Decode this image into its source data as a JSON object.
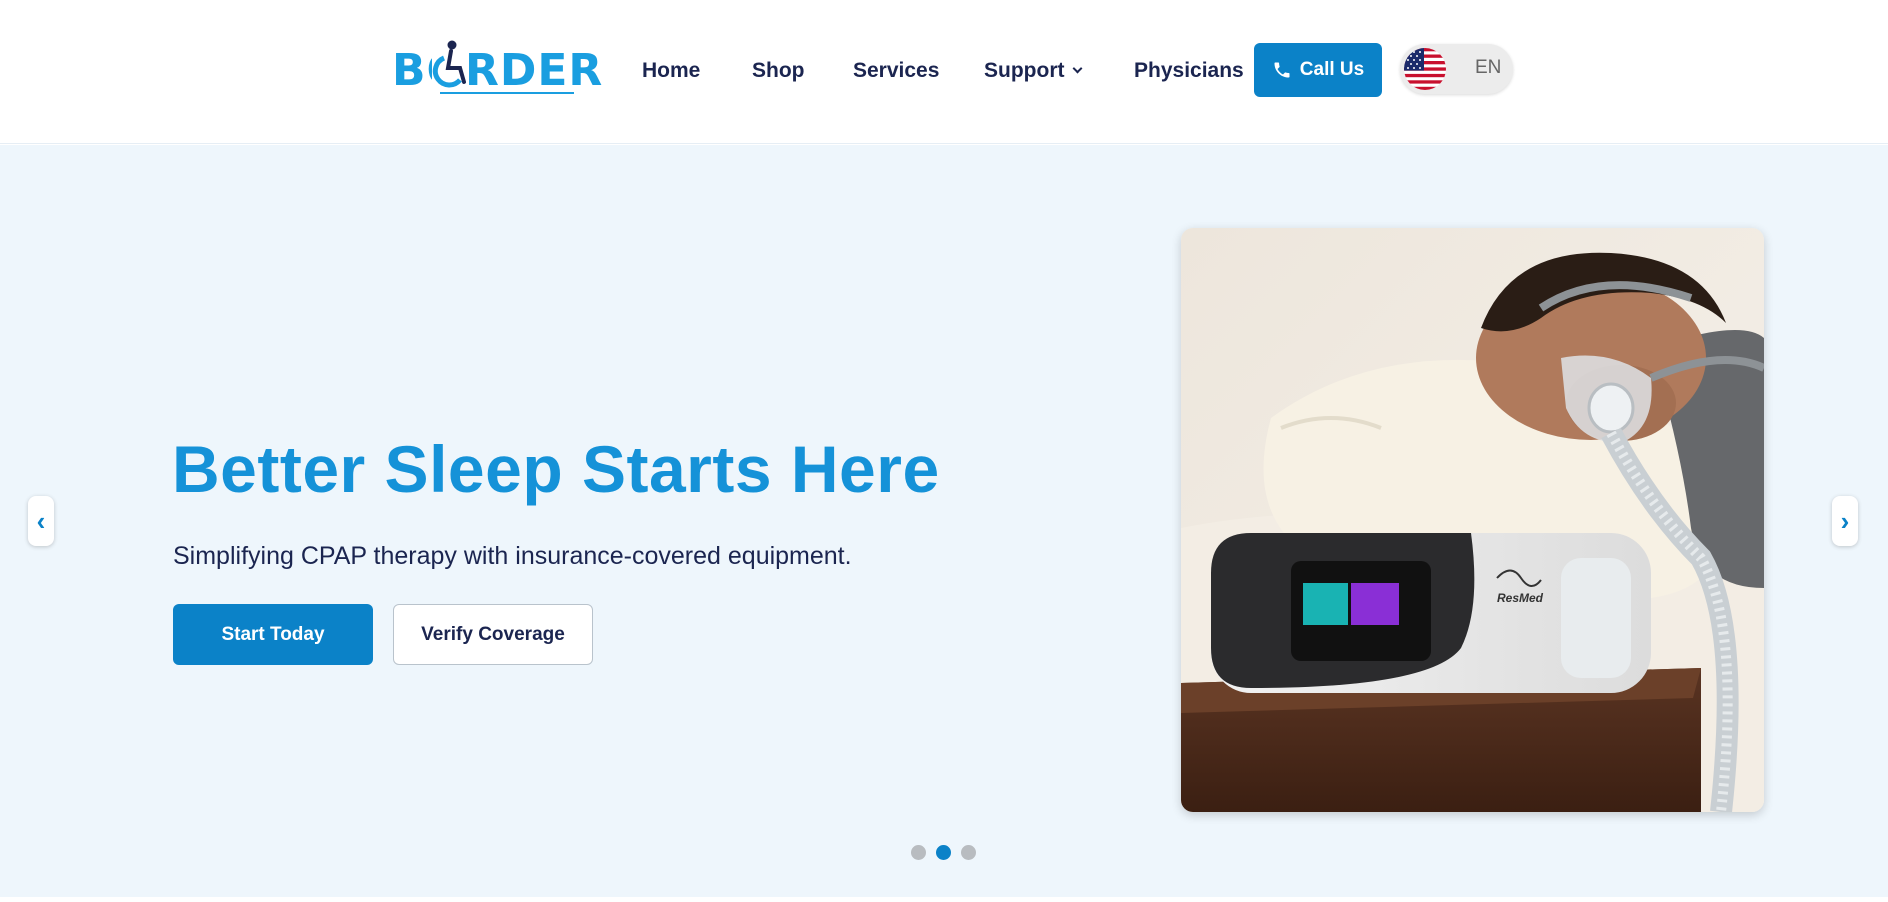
{
  "header": {
    "logo_text": "BORDER",
    "nav": [
      {
        "label": "Home"
      },
      {
        "label": "Shop"
      },
      {
        "label": "Services"
      },
      {
        "label": "Support"
      },
      {
        "label": "Physicians"
      }
    ],
    "call_label": "Call Us",
    "language": "EN"
  },
  "hero": {
    "title": "Better Sleep Starts Here",
    "subtitle": "Simplifying CPAP therapy with insurance-covered equipment.",
    "primary_button": "Start Today",
    "secondary_button": "Verify Coverage",
    "prev_arrow": "‹",
    "next_arrow": "›",
    "device_brand": "ResMed",
    "slides_total": 3,
    "active_slide": 2
  },
  "colors": {
    "brand_blue": "#1592d8",
    "button_blue": "#0b82c8",
    "hero_bg": "#eef6fc",
    "nav_text": "#1b2550"
  },
  "icons": [
    "wheelchair-figure-icon",
    "phone-icon",
    "us-flag-icon",
    "chevron-down-icon",
    "chevron-left-icon",
    "chevron-right-icon"
  ]
}
